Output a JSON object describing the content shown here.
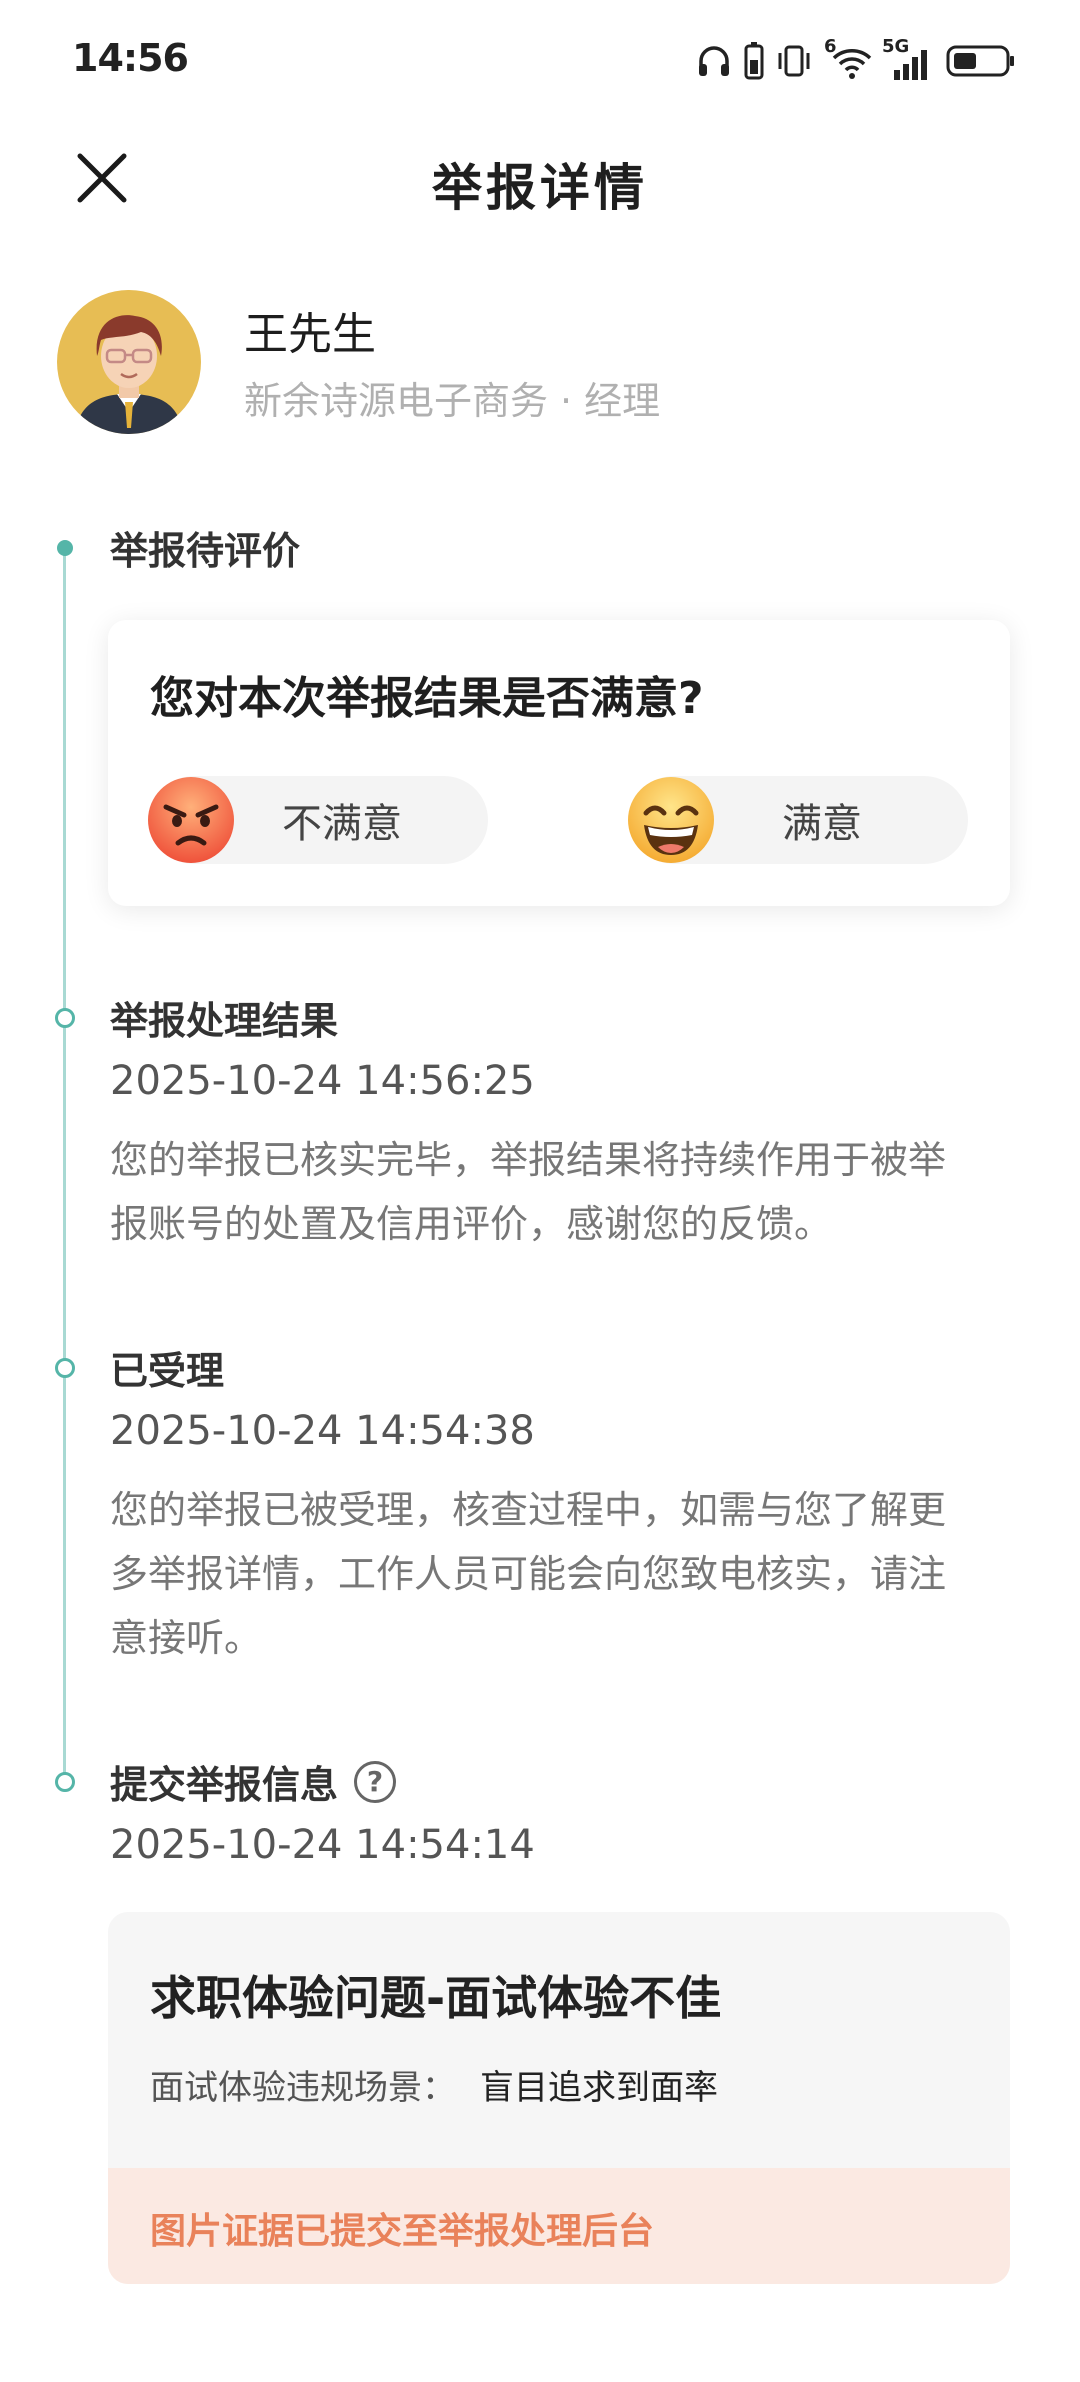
{
  "status_bar": {
    "time": "14:56",
    "network": "5G",
    "wifi_badge": "6",
    "icons": [
      "headphones-icon",
      "phone-battery-icon",
      "vibrate-icon",
      "wifi-icon",
      "signal-icon",
      "battery-icon"
    ]
  },
  "header": {
    "title": "举报详情",
    "close_icon": "close-icon"
  },
  "user": {
    "name": "王先生",
    "company": "新余诗源电子商务",
    "separator": "·",
    "position": "经理"
  },
  "timeline": {
    "pending": {
      "title": "举报待评价",
      "question": "您对本次举报结果是否满意?",
      "unsatisfied_label": "不满意",
      "satisfied_label": "满意"
    },
    "result": {
      "title": "举报处理结果",
      "time": "2025-10-24 14:56:25",
      "desc_line1": "您的举报已核实完毕，举报结果将持续作用于被举",
      "desc_line2": "报账号的处置及信用评价，感谢您的反馈。"
    },
    "accepted": {
      "title": "已受理",
      "time": "2025-10-24 14:54:38",
      "desc_line1": "您的举报已被受理，核查过程中，如需与您了解更",
      "desc_line2": "多举报详情，工作人员可能会向您致电核实，请注",
      "desc_line3": "意接听。"
    },
    "submitted": {
      "title": "提交举报信息",
      "help_glyph": "?",
      "time": "2025-10-24 14:54:14"
    }
  },
  "report": {
    "title": "求职体验问题-面试体验不佳",
    "field_label": "面试体验违规场景：",
    "field_value": "盲目追求到面率",
    "footer": "图片证据已提交至举报处理后台"
  },
  "colors": {
    "accent": "#55b5a8",
    "timeline_line": "#a8d9d3",
    "warning_text": "#e9825a",
    "warning_bg": "#fbe9e2"
  }
}
